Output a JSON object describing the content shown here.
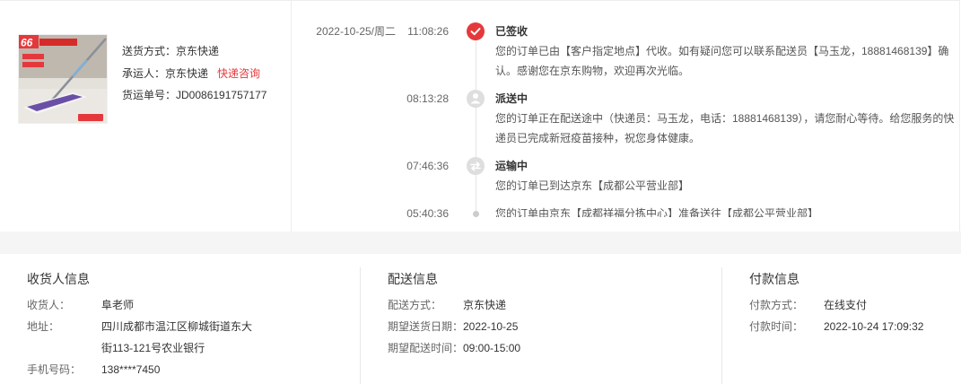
{
  "colors": {
    "accent": "#e4393c",
    "text": "#333333",
    "muted": "#666666",
    "band": "#f5f5f5",
    "divider": "#e8e8e8",
    "icon_gray": "#dedede"
  },
  "product": {
    "image": "mop-product-image",
    "badge": "66"
  },
  "shipment": {
    "method_label": "送货方式：",
    "method": "京东快递",
    "carrier_label": "承运人：",
    "carrier": "京东快递",
    "consult_link": "快递咨询",
    "tracking_label": "货运单号：",
    "tracking_no": "JD0086191757177"
  },
  "timeline": [
    {
      "date": "2022-10-25/周二",
      "time": "11:08:26",
      "status": "已签收",
      "desc": "您的订单已由【客户指定地点】代收。如有疑问您可以联系配送员【马玉龙，18881468139】确认。感谢您在京东购物，欢迎再次光临。",
      "icon": "check-icon"
    },
    {
      "time": "08:13:28",
      "status": "派送中",
      "desc": "您的订单正在配送途中（快递员：马玉龙，电话：18881468139），请您耐心等待。给您服务的快递员已完成新冠疫苗接种，祝您身体健康。",
      "icon": "courier-icon"
    },
    {
      "time": "07:46:36",
      "status": "运输中",
      "desc": "您的订单已到达京东【成都公平营业部】",
      "icon": "transit-icon"
    },
    {
      "time": "05:40:36",
      "desc": "您的订单由京东【成都祥福分拣中心】准备送往【成都公平营业部】",
      "icon": "dot-icon"
    }
  ],
  "receiver": {
    "title": "收货人信息",
    "rows": [
      {
        "label": "收货人：",
        "value": "阜老师"
      },
      {
        "label": "地址：",
        "value": "四川成都市温江区柳城街道东大街113-121号农业银行"
      },
      {
        "label": "手机号码：",
        "value": "138****7450"
      }
    ]
  },
  "delivery": {
    "title": "配送信息",
    "rows": [
      {
        "label": "配送方式：",
        "value": "京东快递"
      },
      {
        "label": "期望送货日期：",
        "value": "2022-10-25"
      },
      {
        "label": "期望配送时间：",
        "value": "09:00-15:00"
      }
    ]
  },
  "payment": {
    "title": "付款信息",
    "rows": [
      {
        "label": "付款方式：",
        "value": "在线支付"
      },
      {
        "label": "付款时间：",
        "value": "2022-10-24 17:09:32"
      }
    ]
  }
}
